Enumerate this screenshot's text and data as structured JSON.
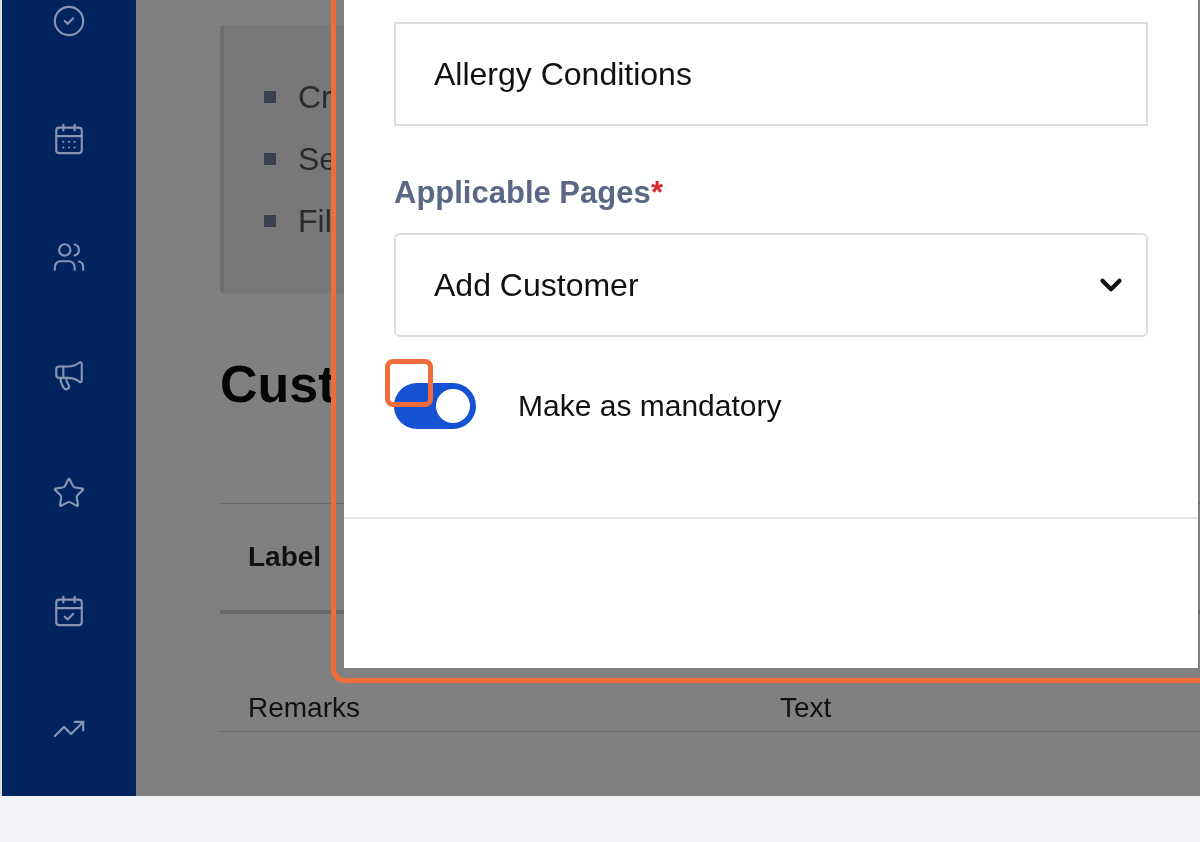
{
  "background_page": {
    "card_items": [
      "Cr",
      "Se",
      "Fil"
    ],
    "heading": "Cust",
    "table": {
      "columns": [
        "Label"
      ],
      "rows": [
        [
          "Remarks",
          "Text"
        ]
      ]
    }
  },
  "dialog": {
    "name_field": {
      "value": "Allergy Conditions"
    },
    "pages_field": {
      "label": "Applicable Pages",
      "required_mark": "*",
      "value": "Add Customer"
    },
    "mandatory_toggle": {
      "label": "Make as mandatory",
      "on": true
    }
  }
}
